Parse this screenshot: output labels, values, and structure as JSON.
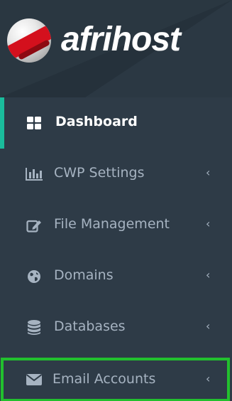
{
  "brand": {
    "name": "afrihost"
  },
  "menu": {
    "items": [
      {
        "label": "Dashboard",
        "icon": "dashboard-icon",
        "active": true,
        "has_submenu": false
      },
      {
        "label": "CWP Settings",
        "icon": "bar-chart-icon",
        "active": false,
        "has_submenu": true
      },
      {
        "label": "File Management",
        "icon": "edit-icon",
        "active": false,
        "has_submenu": true
      },
      {
        "label": "Domains",
        "icon": "globe-icon",
        "active": false,
        "has_submenu": true
      },
      {
        "label": "Databases",
        "icon": "database-icon",
        "active": false,
        "has_submenu": true
      },
      {
        "label": "Email Accounts",
        "icon": "envelope-icon",
        "active": false,
        "has_submenu": true
      }
    ],
    "chevron": "‹"
  },
  "colors": {
    "sidebar_bg": "#2e3b47",
    "active_accent": "#1abc9c",
    "highlight_border": "#22c02e",
    "text_muted": "#a6b3c1",
    "text_active": "#ffffff",
    "logo_red": "#d4101d"
  }
}
